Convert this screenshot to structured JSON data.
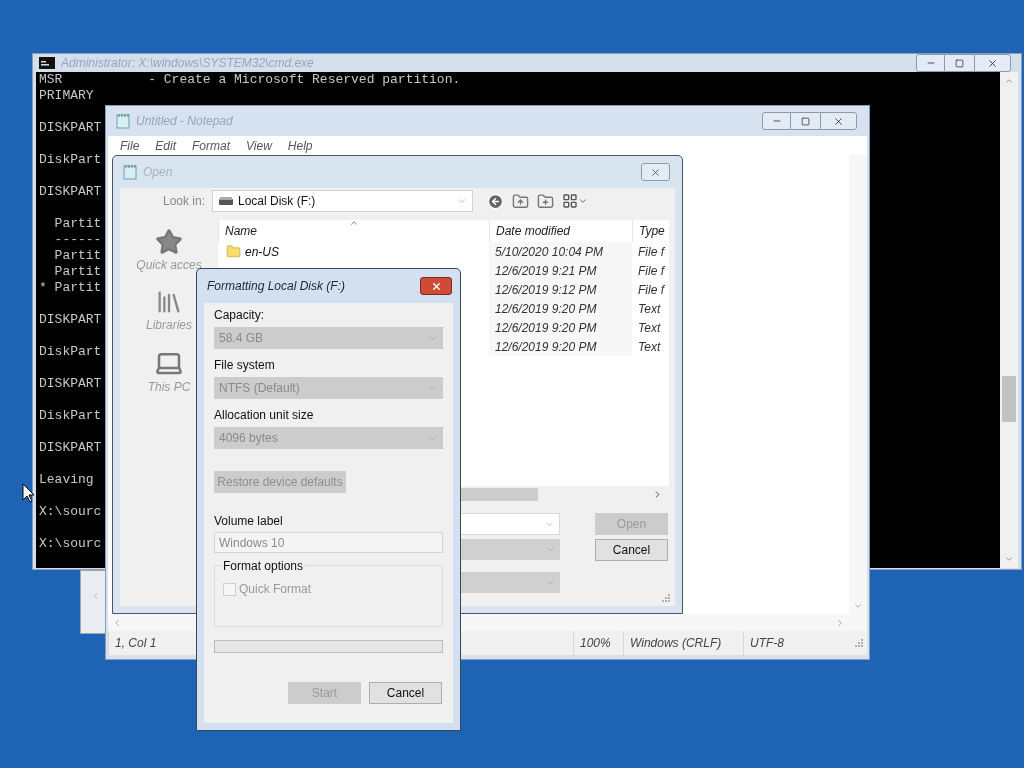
{
  "console_window": {
    "title": "Administrator: X:\\windows\\SYSTEM32\\cmd.exe",
    "blocks": [
      [
        "MSR           - Create a Microsoft Reserved partition.",
        "PRIMARY"
      ],
      [
        "DISKPART"
      ],
      [
        "DiskPart"
      ],
      [
        "DISKPART"
      ],
      [
        "  Partit",
        "  ------",
        "  Partit",
        "  Partit",
        "* Partit"
      ],
      [
        "DISKPART"
      ],
      [
        "DiskPart"
      ],
      [
        "DISKPART"
      ],
      [
        "DiskPart"
      ],
      [
        "DISKPART"
      ],
      [
        "Leaving"
      ],
      [
        "X:\\sourc"
      ],
      [
        "X:\\sourc"
      ]
    ]
  },
  "notepad_window": {
    "title": "Untitled - Notepad",
    "menu": [
      "File",
      "Edit",
      "Format",
      "View",
      "Help"
    ],
    "status_bar": [
      "1, Col 1",
      "100%",
      "Windows (CRLF)",
      "UTF-8"
    ]
  },
  "open_dialog": {
    "title": "Open",
    "look_in": {
      "label": "Look in:",
      "value": "Local Disk (F:)"
    },
    "places": [
      {
        "label": "Quick acces",
        "kind": "star"
      },
      {
        "label": "Libraries",
        "kind": "library"
      },
      {
        "label": "This PC",
        "kind": "computer"
      }
    ],
    "columns": [
      "Name",
      "Date modified",
      "Type"
    ],
    "rows": [
      {
        "name": "en-US",
        "date": "5/10/2020 10:04 PM",
        "type": "File f"
      },
      {
        "date": "12/6/2019 9:21 PM",
        "type": "File f"
      },
      {
        "date": "12/6/2019 9:12 PM",
        "type": "File f"
      },
      {
        "date": "12/6/2019 9:20 PM",
        "type": "Text"
      },
      {
        "date": "12/6/2019 9:20 PM",
        "type": "Text"
      },
      {
        "date": "12/6/2019 9:20 PM",
        "type": "Text"
      }
    ],
    "buttons": [
      {
        "label": "Open",
        "disabled": true
      },
      {
        "label": "Cancel",
        "disabled": false
      }
    ]
  },
  "format_dialog": {
    "title": "Formatting Local Disk (F:)",
    "selects": [
      {
        "label": "Capacity:",
        "value": "58.4 GB",
        "disabled": true
      },
      {
        "label": "File system",
        "value": "NTFS (Default)",
        "disabled": true
      },
      {
        "label": "Allocation unit size",
        "value": "4096 bytes",
        "disabled": true
      }
    ],
    "restore_button": {
      "label": "Restore device defaults",
      "disabled": true
    },
    "volume_label": {
      "label": "Volume label",
      "value": "Windows 10",
      "disabled": true
    },
    "format_options": {
      "title": "Format options",
      "quick_format": {
        "label": "Quick Format",
        "checked": false,
        "disabled": true
      }
    },
    "progress": {
      "level": 0
    },
    "buttons": [
      {
        "label": "Start",
        "disabled": true
      },
      {
        "label": "Cancel",
        "disabled": false
      }
    ]
  }
}
